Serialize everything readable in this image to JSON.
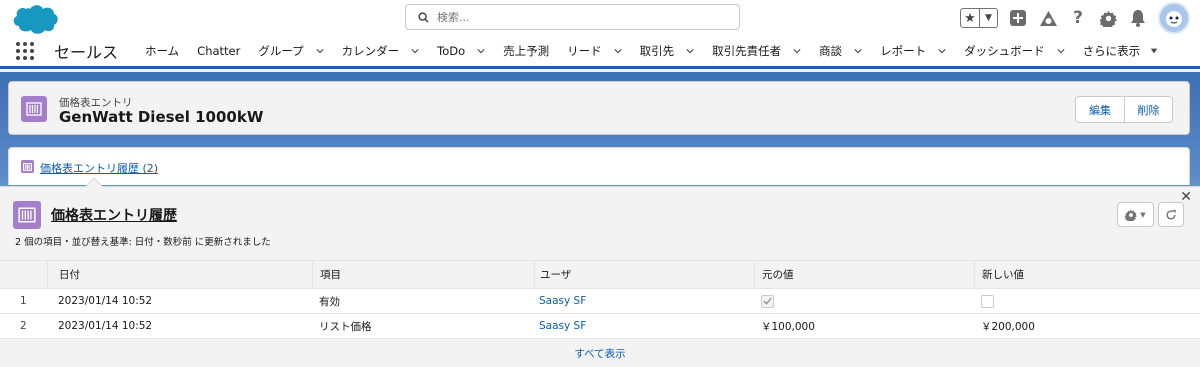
{
  "search": {
    "placeholder": "検索..."
  },
  "nav": {
    "app_name": "セールス",
    "items": [
      {
        "label": "ホーム",
        "dropdown": false
      },
      {
        "label": "Chatter",
        "dropdown": false
      },
      {
        "label": "グループ",
        "dropdown": true
      },
      {
        "label": "カレンダー",
        "dropdown": true
      },
      {
        "label": "ToDo",
        "dropdown": true
      },
      {
        "label": "売上予測",
        "dropdown": false
      },
      {
        "label": "リード",
        "dropdown": true
      },
      {
        "label": "取引先",
        "dropdown": true
      },
      {
        "label": "取引先責任者",
        "dropdown": true
      },
      {
        "label": "商談",
        "dropdown": true
      },
      {
        "label": "レポート",
        "dropdown": true
      },
      {
        "label": "ダッシュボード",
        "dropdown": true
      },
      {
        "label": "さらに表示",
        "dropdown": true
      }
    ]
  },
  "record": {
    "object_label": "価格表エントリ",
    "title": "GenWatt Diesel 1000kW",
    "edit_label": "編集",
    "delete_label": "削除"
  },
  "related_tab": {
    "label": "価格表エントリ履歴 (2)"
  },
  "related_list": {
    "title": "価格表エントリ履歴",
    "meta": "2 個の項目・並び替え基準: 日付・数秒前 に更新されました",
    "columns": [
      "",
      "日付",
      "項目",
      "ユーザ",
      "元の値",
      "新しい値"
    ],
    "rows": [
      {
        "num": "1",
        "date": "2023/01/14 10:52",
        "field": "有効",
        "user": "Saasy SF",
        "old_value": "",
        "old_checked": true,
        "new_value": "",
        "new_checked": false
      },
      {
        "num": "2",
        "date": "2023/01/14 10:52",
        "field": "リスト価格",
        "user": "Saasy SF",
        "old_value": "￥100,000",
        "new_value": "￥200,000"
      }
    ],
    "show_all": "すべて表示"
  },
  "colors": {
    "brand_blue": "#0b5cab",
    "object_icon": "#a47ecb",
    "nav_border": "#1b5fa6"
  }
}
